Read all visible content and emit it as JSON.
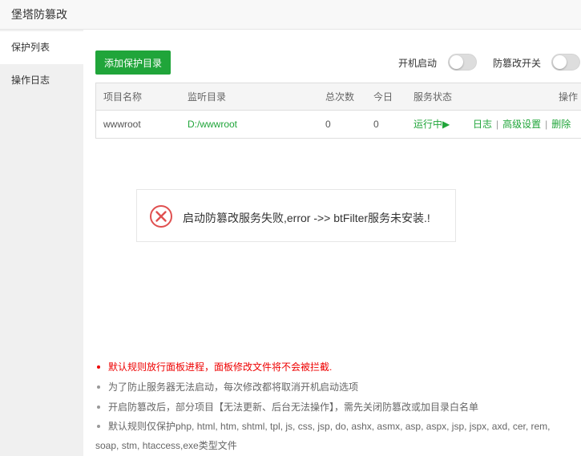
{
  "window": {
    "title": "堡塔防篡改"
  },
  "sidebar": {
    "items": [
      {
        "label": "保护列表",
        "active": true
      },
      {
        "label": "操作日志",
        "active": false
      }
    ]
  },
  "toolbar": {
    "add_label": "添加保护目录",
    "autostart_label": "开机启动",
    "autostart_on": false,
    "tamper_label": "防篡改开关",
    "tamper_on": false
  },
  "table": {
    "headers": {
      "name": "项目名称",
      "dir": "监听目录",
      "total": "总次数",
      "today": "今日",
      "status": "服务状态",
      "ops": "操作"
    },
    "rows": [
      {
        "name": "wwwroot",
        "dir": "D:/wwwroot",
        "total": "0",
        "today": "0",
        "status": "运行中▶",
        "ops": {
          "log": "日志",
          "advanced": "高级设置",
          "delete": "删除",
          "sep": "|"
        }
      }
    ]
  },
  "alert": {
    "message": "启动防篡改服务失败,error ->> btFilter服务未安装.!",
    "color": "#e05050"
  },
  "notes": [
    "默认规则放行面板进程，面板修改文件将不会被拦截.",
    "为了防止服务器无法启动，每次修改都将取消开机启动选项",
    "开启防篡改后，部分项目【无法更新、后台无法操作】，需先关闭防篡改或加目录白名单",
    "默认规则仅保护php, html, htm, shtml, tpl, js, css, jsp, do, ashx, asmx, asp, aspx, jsp, jspx, axd, cer, rem, soap, stm, htaccess,exe类型文件"
  ],
  "colors": {
    "accent": "#20a53a",
    "warning": "#ee0000"
  }
}
